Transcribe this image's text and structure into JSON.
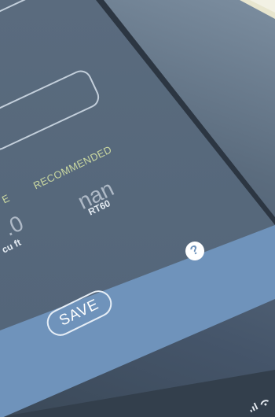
{
  "results": {
    "recommended_label": "RECOMMENDED",
    "recommended_value": "nan",
    "recommended_unit": "RT60",
    "left_label_fragment": "E",
    "left_value_fragment": ".0",
    "left_unit": "cu ft"
  },
  "actions": {
    "help_symbol": "?",
    "save_label": "SAVE"
  },
  "colors": {
    "screen": "#56687b",
    "panel": "#6f93bb",
    "label_accent": "#c9d7a0"
  },
  "status_bar": {
    "signal_icon": "signal-wifi-icon"
  }
}
